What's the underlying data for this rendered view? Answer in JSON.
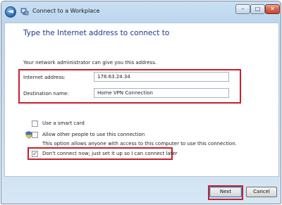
{
  "window": {
    "title": "Connect to a Workplace",
    "controls": {
      "minimize": "–",
      "maximize": "□",
      "close": "✕"
    },
    "back_glyph": "◄"
  },
  "page": {
    "heading": "Type the Internet address to connect to",
    "description": "Your network administrator can give you this address."
  },
  "fields": {
    "internet_address": {
      "label": "Internet address:",
      "value": "178.63.24.34"
    },
    "destination_name": {
      "label": "Destination name:",
      "value": "Home VPN Connection"
    }
  },
  "options": {
    "smart_card": {
      "label": "Use a smart card",
      "checked": false
    },
    "allow_others": {
      "label": "Allow other people to use this connection",
      "note": "This option allows anyone with access to this computer to use this connection.",
      "checked": false
    },
    "dont_connect": {
      "label": "Don't connect now; just set it up so I can connect later",
      "checked": true,
      "check_glyph": "✓"
    }
  },
  "buttons": {
    "next": "Next",
    "cancel": "Cancel"
  },
  "colors": {
    "highlight": "#c8202a",
    "heading": "#1d3a8a"
  },
  "icons": [
    "back-arrow-icon",
    "workplace-network-icon",
    "uac-shield-icon"
  ]
}
